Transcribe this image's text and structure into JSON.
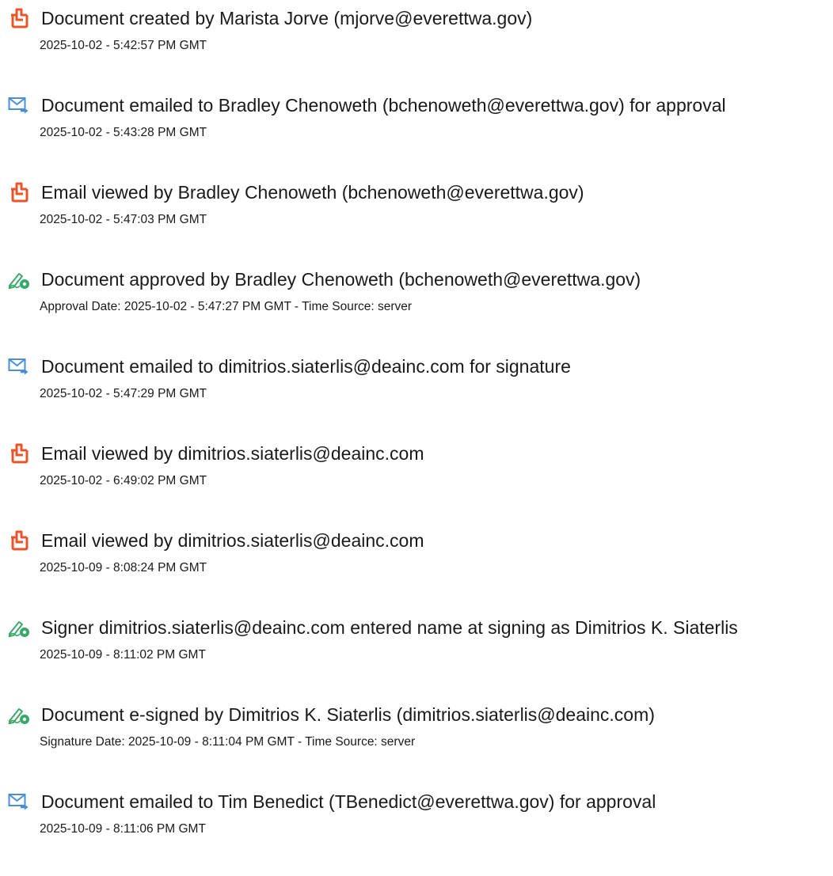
{
  "colors": {
    "doc_icon": "#e8552a",
    "mail_icon": "#4a8fd6",
    "sign_icon": "#35a86a",
    "text": "#1a1a1a"
  },
  "events": [
    {
      "icon": "document-icon",
      "title": "Document created by Marista Jorve (mjorve@everettwa.gov)",
      "detail": "2025-10-02 - 5:42:57 PM GMT"
    },
    {
      "icon": "email-icon",
      "title": "Document emailed to Bradley Chenoweth (bchenoweth@everettwa.gov) for approval",
      "detail": "2025-10-02 - 5:43:28 PM GMT"
    },
    {
      "icon": "document-icon",
      "title": "Email viewed by Bradley Chenoweth (bchenoweth@everettwa.gov)",
      "detail": "2025-10-02 - 5:47:03 PM GMT"
    },
    {
      "icon": "signature-icon",
      "title": "Document approved by Bradley Chenoweth (bchenoweth@everettwa.gov)",
      "detail": "Approval Date: 2025-10-02 - 5:47:27 PM GMT - Time Source: server"
    },
    {
      "icon": "email-icon",
      "title": "Document emailed to dimitrios.siaterlis@deainc.com for signature",
      "detail": "2025-10-02 - 5:47:29 PM GMT"
    },
    {
      "icon": "document-icon",
      "title": "Email viewed by dimitrios.siaterlis@deainc.com",
      "detail": "2025-10-02 - 6:49:02 PM GMT"
    },
    {
      "icon": "document-icon",
      "title": "Email viewed by dimitrios.siaterlis@deainc.com",
      "detail": "2025-10-09 - 8:08:24 PM GMT"
    },
    {
      "icon": "signature-icon",
      "title": "Signer dimitrios.siaterlis@deainc.com entered name at signing as Dimitrios K. Siaterlis",
      "detail": "2025-10-09 - 8:11:02 PM GMT"
    },
    {
      "icon": "signature-icon",
      "title": "Document e-signed by Dimitrios K. Siaterlis (dimitrios.siaterlis@deainc.com)",
      "detail": "Signature Date: 2025-10-09 - 8:11:04 PM GMT - Time Source: server"
    },
    {
      "icon": "email-icon",
      "title": "Document emailed to Tim Benedict (TBenedict@everettwa.gov) for approval",
      "detail": "2025-10-09 - 8:11:06 PM GMT"
    }
  ]
}
